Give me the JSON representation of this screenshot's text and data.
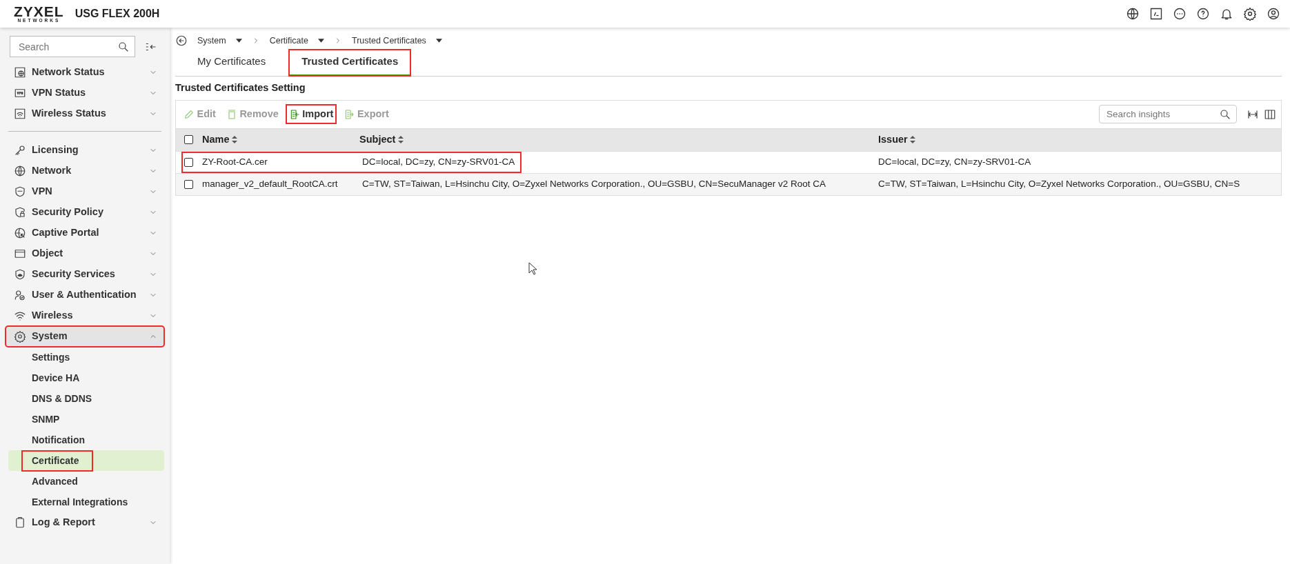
{
  "header": {
    "logo": "ZYXEL",
    "logo_sub": "NETWORKS",
    "model": "USG FLEX 200H"
  },
  "sidebar": {
    "search": {
      "placeholder": "Search"
    },
    "status_items": [
      {
        "label": "Network Status",
        "expanded": false
      },
      {
        "label": "VPN Status",
        "expanded": false
      },
      {
        "label": "Wireless Status",
        "expanded": false
      }
    ],
    "menu_items": [
      {
        "label": "Licensing",
        "expanded": false,
        "highlighted": false
      },
      {
        "label": "Network",
        "expanded": false,
        "highlighted": false
      },
      {
        "label": "VPN",
        "expanded": false,
        "highlighted": false
      },
      {
        "label": "Security Policy",
        "expanded": false,
        "highlighted": false
      },
      {
        "label": "Captive Portal",
        "expanded": false,
        "highlighted": false
      },
      {
        "label": "Object",
        "expanded": false,
        "highlighted": false
      },
      {
        "label": "Security Services",
        "expanded": false,
        "highlighted": false
      },
      {
        "label": "User & Authentication",
        "expanded": false,
        "highlighted": false
      },
      {
        "label": "Wireless",
        "expanded": false,
        "highlighted": false
      },
      {
        "label": "System",
        "expanded": true,
        "highlighted": true,
        "children": [
          {
            "label": "Settings",
            "selected": false,
            "highlighted": false
          },
          {
            "label": "Device HA",
            "selected": false,
            "highlighted": false
          },
          {
            "label": "DNS & DDNS",
            "selected": false,
            "highlighted": false
          },
          {
            "label": "SNMP",
            "selected": false,
            "highlighted": false
          },
          {
            "label": "Notification",
            "selected": false,
            "highlighted": false
          },
          {
            "label": "Certificate",
            "selected": true,
            "highlighted": true
          },
          {
            "label": "Advanced",
            "selected": false,
            "highlighted": false
          },
          {
            "label": "External Integrations",
            "selected": false,
            "highlighted": false
          }
        ]
      },
      {
        "label": "Log & Report",
        "expanded": false,
        "highlighted": false
      }
    ]
  },
  "breadcrumb": [
    "System",
    "Certificate",
    "Trusted Certificates"
  ],
  "tabs": [
    {
      "label": "My Certificates",
      "selected": false,
      "highlighted": false
    },
    {
      "label": "Trusted Certificates",
      "selected": true,
      "highlighted": true
    }
  ],
  "section_title": "Trusted Certificates Setting",
  "toolbar": {
    "actions": [
      {
        "label": "Edit",
        "disabled": true,
        "highlighted": false
      },
      {
        "label": "Remove",
        "disabled": true,
        "highlighted": false
      },
      {
        "label": "Import",
        "disabled": false,
        "highlighted": true
      },
      {
        "label": "Export",
        "disabled": true,
        "highlighted": false
      }
    ],
    "search": {
      "placeholder": "Search insights"
    }
  },
  "table": {
    "all_checked": false,
    "columns": [
      "Name",
      "Subject",
      "Issuer"
    ],
    "rows": [
      {
        "checked": false,
        "highlighted": true,
        "cells": [
          "ZY-Root-CA.cer",
          "DC=local, DC=zy, CN=zy-SRV01-CA",
          "DC=local, DC=zy, CN=zy-SRV01-CA"
        ]
      },
      {
        "checked": false,
        "highlighted": false,
        "cells": [
          "manager_v2_default_RootCA.crt",
          "C=TW, ST=Taiwan, L=Hsinchu City, O=Zyxel Networks Corporation., OU=GSBU, CN=SecuManager v2 Root CA",
          "C=TW, ST=Taiwan, L=Hsinchu City, O=Zyxel Networks Corporation., OU=GSBU, CN=S"
        ]
      }
    ]
  }
}
